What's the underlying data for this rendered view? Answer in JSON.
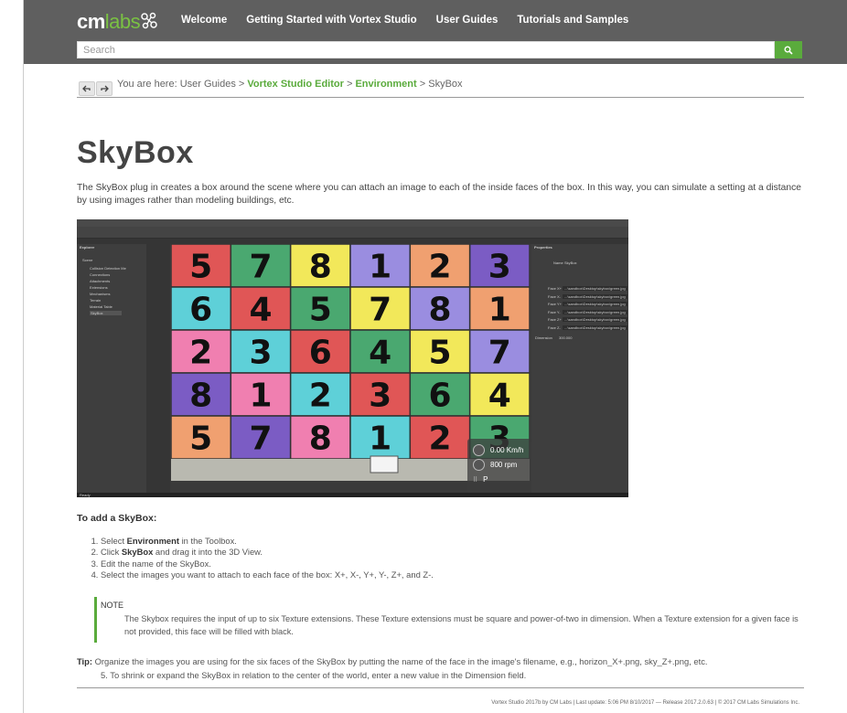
{
  "header": {
    "logo_text_a": "cm",
    "logo_text_b": "labs",
    "nav": [
      "Welcome",
      "Getting Started with Vortex Studio",
      "User Guides",
      "Tutorials and Samples"
    ],
    "search_placeholder": "Search",
    "accent_color": "#5aab3c",
    "bar_color": "#5f5f5f"
  },
  "breadcrumb": {
    "prefix": "You are here: User Guides > ",
    "item1": "Vortex Studio Editor",
    "sep1": " > ",
    "item2": "Environment",
    "sep2": " > ",
    "current": "SkyBox"
  },
  "page": {
    "title": "SkyBox",
    "intro": "The SkyBox plug in creates a box around the scene where you can attach an image to each of the inside faces of the box. In this way, you can simulate a setting at a distance by using images rather than modeling buildings, etc."
  },
  "screenshot": {
    "explorer_title": "Explorer",
    "explorer_items": [
      "Scene",
      "Collision Detection Me",
      "Connections",
      "Attachments",
      "Extensions",
      "Mechanisms",
      "Terrain",
      "Material Table",
      "SkyBox"
    ],
    "properties_title": "Properties",
    "properties_name_label": "Name",
    "properties_name_value": "SkyBox",
    "face_rows": [
      "Face X+",
      "Face X-",
      "Face Y+",
      "Face Y-",
      "Face Z+",
      "Face Z-"
    ],
    "face_path": "...\\sandbox\\Desktop\\skybox\\green.jpg",
    "dimension_label": "Dimension",
    "dimension_value": "300.000",
    "hud_speed": "0.00 Km/h",
    "hud_rpm": "800 rpm",
    "hud_gear": "P",
    "status_label": "Ready"
  },
  "instructions": {
    "heading": "To add a SkyBox:",
    "step1_a": "Select ",
    "step1_b": "Environment",
    "step1_c": " in the Toolbox.",
    "step2_a": "Click ",
    "step2_b": "SkyBox",
    "step2_c": " and drag it into the 3D View.",
    "step3": "Edit the name of the SkyBox.",
    "step4": "Select the images you want to attach to each face of the box: X+, X-, Y+, Y-, Z+, and Z-.",
    "note_title": "NOTE",
    "note_body": "The Skybox requires the input of up to six Texture extensions. These Texture extensions must be square and power-of-two in dimension. When a Texture extension for a given face is not provided, this face will be filled with black.",
    "tip_label": "Tip:",
    "tip_body": " Organize the images you are using for the six faces of the SkyBox by putting the name of the face in the image's filename, e.g., horizon_X+.png, sky_Z+.png, etc.",
    "step5": "5. To shrink or expand the SkyBox in relation to the center of the world, enter a new value in the Dimension field."
  },
  "footer": {
    "text": "Vortex Studio 2017b by CM Labs  |  Last update: 5:06 PM 8/10/2017 — Release 2017.2.0.63  |  © 2017 CM Labs Simulations Inc."
  }
}
